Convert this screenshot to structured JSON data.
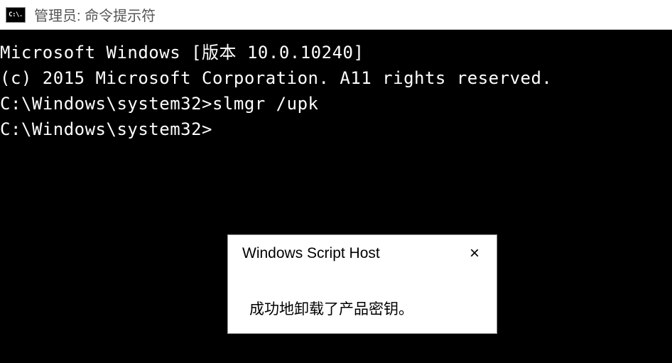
{
  "window": {
    "icon_label": "C:\\.",
    "title": "管理员: 命令提示符"
  },
  "terminal": {
    "lines": [
      "Microsoft Windows [版本 10.0.10240]",
      "(c) 2015 Microsoft Corporation. A11 rights reserved.",
      "",
      "C:\\Windows\\system32>slmgr /upk",
      "",
      "C:\\Windows\\system32>"
    ]
  },
  "dialog": {
    "title": "Windows Script Host",
    "close_label": "×",
    "message": "成功地卸载了产品密钥。"
  }
}
